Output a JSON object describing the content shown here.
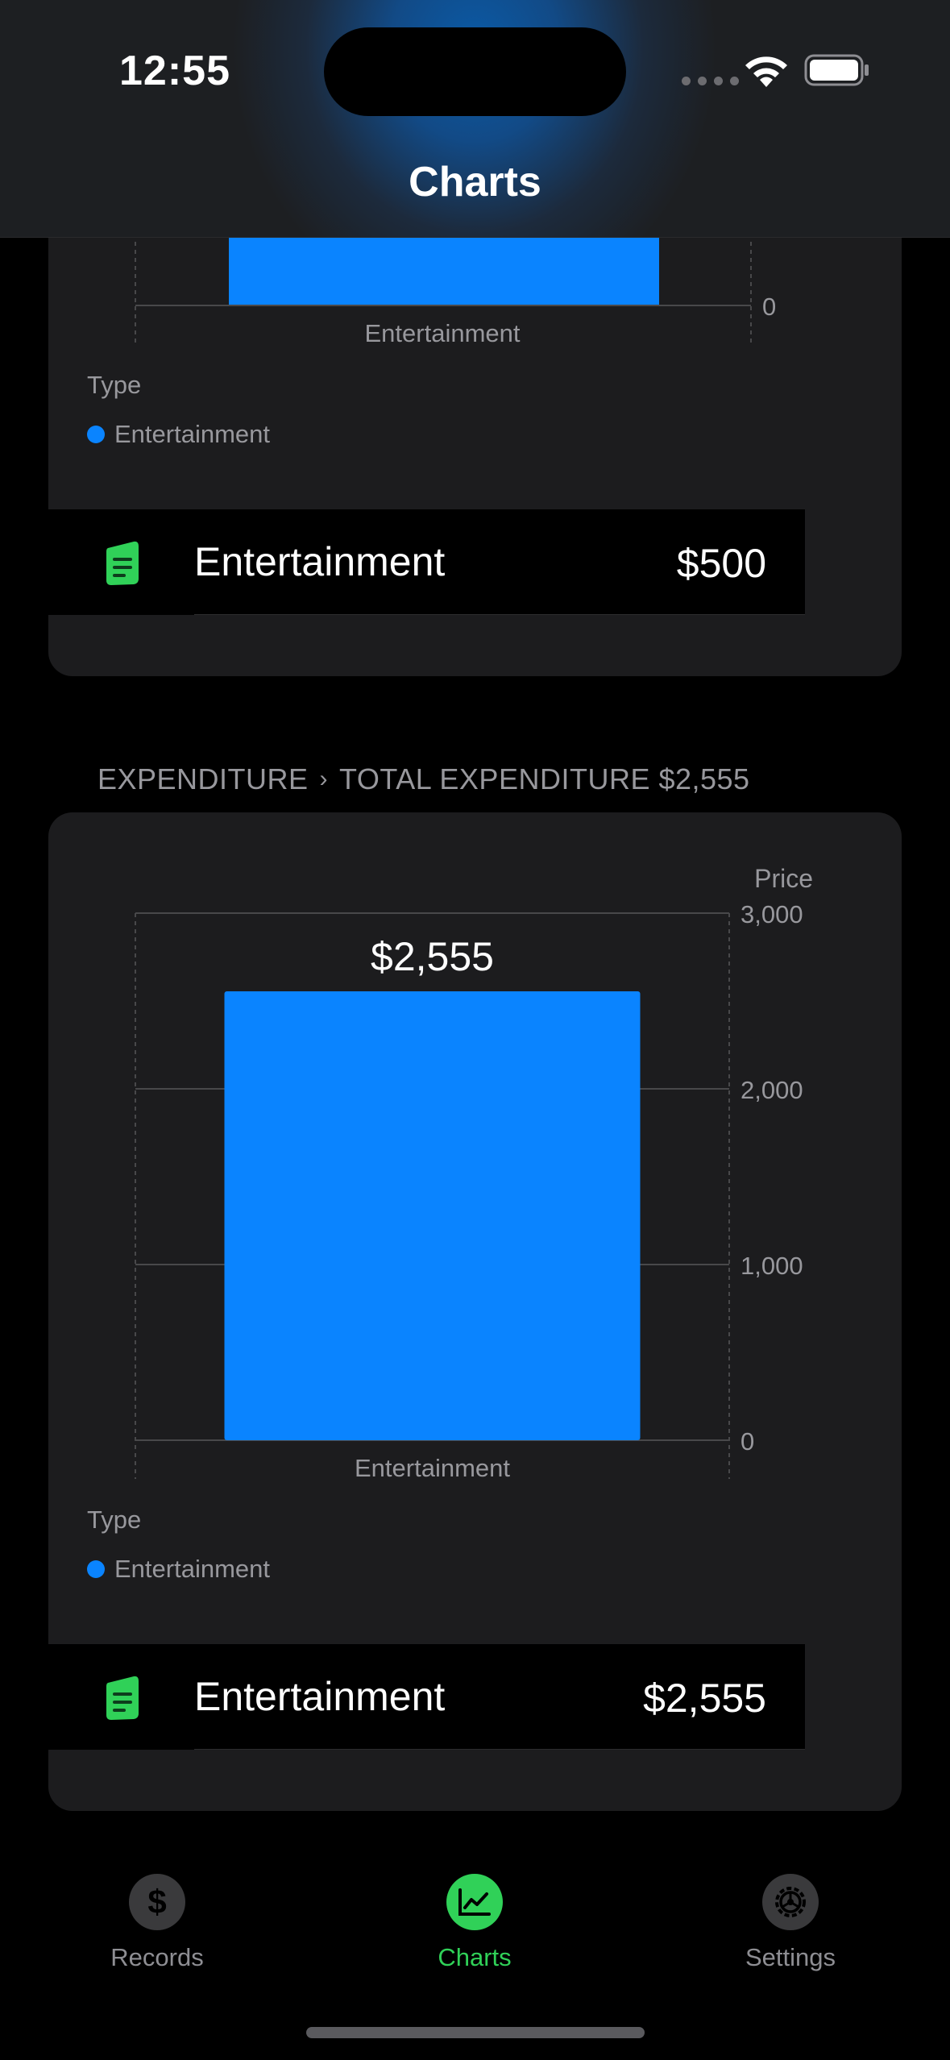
{
  "status_bar": {
    "time": "12:55"
  },
  "nav": {
    "title": "Charts"
  },
  "colors": {
    "accent": "#0a84ff",
    "green": "#30d158",
    "card": "#1c1c1e"
  },
  "top_section": {
    "legend_title": "Type",
    "legend_item": "Entertainment",
    "row": {
      "icon": "document-icon",
      "label": "Entertainment",
      "value": "$500"
    }
  },
  "expenditure_section": {
    "header_left": "EXPENDITURE",
    "header_right": "TOTAL EXPENDITURE $2,555",
    "legend_title": "Type",
    "legend_item": "Entertainment",
    "row": {
      "icon": "document-icon",
      "label": "Entertainment",
      "value": "$2,555"
    }
  },
  "chart_data": [
    {
      "type": "bar",
      "categories": [
        "Entertainment"
      ],
      "values": [
        500
      ],
      "y_ticks_visible": [
        "0"
      ],
      "legend": [
        "Entertainment"
      ],
      "legend_title": "Type",
      "note": ""
    },
    {
      "type": "bar",
      "categories": [
        "Entertainment"
      ],
      "values": [
        2555
      ],
      "value_label": "$2,555",
      "ylabel": "Price",
      "ylim": [
        0,
        3000
      ],
      "y_ticks": [
        0,
        1000,
        2000,
        3000
      ],
      "y_tick_labels": [
        "0",
        "1,000",
        "2,000",
        "3,000"
      ],
      "legend": [
        "Entertainment"
      ],
      "legend_title": "Type",
      "grid": true,
      "y_axis_position": "right"
    }
  ],
  "tabbar": {
    "tabs": [
      {
        "label": "Records",
        "icon": "dollar-icon",
        "active": false
      },
      {
        "label": "Charts",
        "icon": "chart-line-icon",
        "active": true
      },
      {
        "label": "Settings",
        "icon": "gear-icon",
        "active": false
      }
    ]
  }
}
